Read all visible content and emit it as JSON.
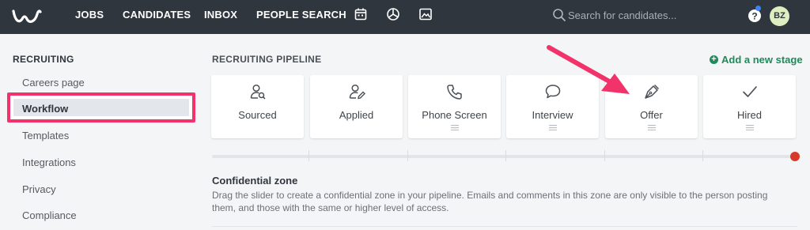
{
  "topbar": {
    "logo_icon": "brand-w-logo",
    "nav": [
      {
        "label": "JOBS"
      },
      {
        "label": "CANDIDATES"
      },
      {
        "label": "INBOX"
      },
      {
        "label": "PEOPLE SEARCH"
      }
    ],
    "nav_icons": [
      "calendar-icon",
      "pie-chart-icon",
      "image-icon"
    ],
    "search": {
      "placeholder": "Search for candidates..."
    },
    "avatar_initials": "BZ",
    "notification_color": "#3b82f6"
  },
  "sidebar": {
    "title": "RECRUITING",
    "items": [
      {
        "label": "Careers page",
        "active": false
      },
      {
        "label": "Workflow",
        "active": true
      },
      {
        "label": "Templates",
        "active": false
      },
      {
        "label": "Integrations",
        "active": false
      },
      {
        "label": "Privacy",
        "active": false
      },
      {
        "label": "Compliance",
        "active": false
      }
    ],
    "highlight_color": "#f2336b"
  },
  "main": {
    "title": "RECRUITING PIPELINE",
    "add_stage_label": "Add a new stage",
    "stages": [
      {
        "label": "Sourced",
        "icon": "user-search-icon",
        "draggable": false
      },
      {
        "label": "Applied",
        "icon": "user-edit-icon",
        "draggable": false
      },
      {
        "label": "Phone Screen",
        "icon": "phone-icon",
        "draggable": true
      },
      {
        "label": "Interview",
        "icon": "chat-bubbles-icon",
        "draggable": true
      },
      {
        "label": "Offer",
        "icon": "pen-nib-icon",
        "draggable": true
      },
      {
        "label": "Hired",
        "icon": "checkmark-icon",
        "draggable": true
      }
    ],
    "slider": {
      "knob_color": "#d83a2a",
      "position": 1.0
    },
    "confidential": {
      "title": "Confidential zone",
      "description": "Drag the slider to create a confidential zone in your pipeline. Emails and comments in this zone are only visible to the person posting them, and those with the same or higher level of access."
    }
  },
  "annotation": {
    "arrow_color": "#f2336b"
  }
}
